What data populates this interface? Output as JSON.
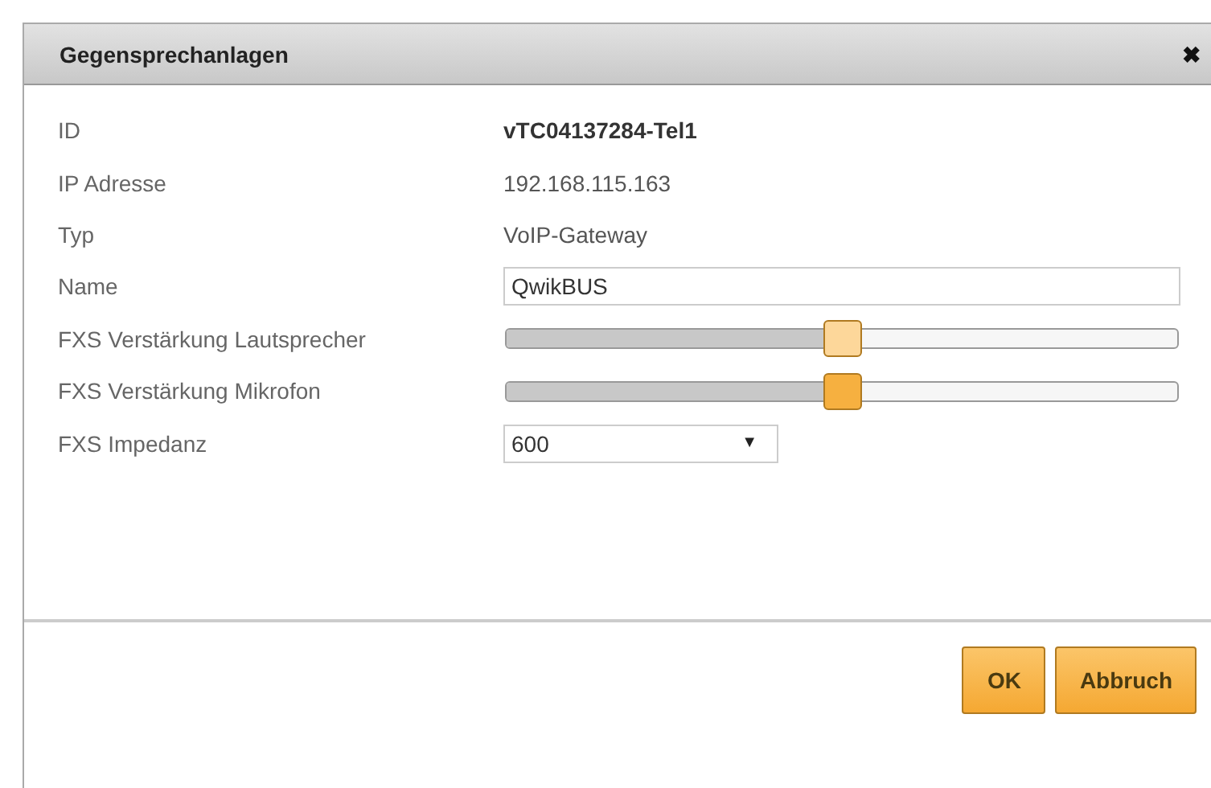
{
  "window": {
    "title": "Gegensprechanlagen",
    "close": "✖"
  },
  "fields": [
    {
      "kind": "text",
      "label": "ID",
      "value": "vTC04137284-Tel1",
      "bold": true
    },
    {
      "kind": "text",
      "label": "IP Adresse",
      "value": "192.168.115.163",
      "bold": false
    },
    {
      "kind": "text",
      "label": "Typ",
      "value": "VoIP-Gateway",
      "bold": false
    },
    {
      "kind": "input",
      "label": "Name",
      "value": "QwikBUS"
    },
    {
      "kind": "slider",
      "label": "FXS Verstärkung Lautsprecher",
      "level": 0.5,
      "hover": true
    },
    {
      "kind": "slider",
      "label": "FXS Verstärkung Mikrofon",
      "level": 0.5,
      "hover": false
    },
    {
      "kind": "select",
      "label": "FXS Impedanz",
      "value": "600",
      "arrow": "▼"
    }
  ],
  "buttons": [
    "OK",
    "Abbruch"
  ]
}
